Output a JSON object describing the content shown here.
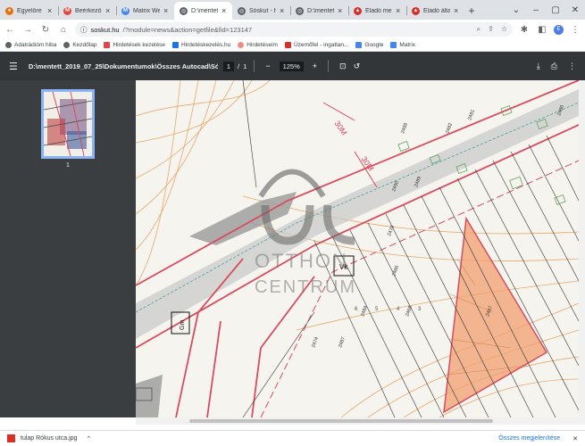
{
  "tabs": [
    {
      "title": "Egyelőre n",
      "favicon_color": "#e8710a",
      "favicon_glyph": "●",
      "active": false
    },
    {
      "title": "Beérkező le",
      "favicon_color": "#ea4335",
      "favicon_glyph": "M",
      "active": false
    },
    {
      "title": "Matrix We",
      "favicon_color": "#4285f4",
      "favicon_glyph": "M",
      "active": false
    },
    {
      "title": "D:\\mentett",
      "favicon_color": "#5f6368",
      "favicon_glyph": "◎",
      "active": true
    },
    {
      "title": "Sóskut - h",
      "favicon_color": "#5f6368",
      "favicon_glyph": "◎",
      "active": false
    },
    {
      "title": "D:\\mentett",
      "favicon_color": "#5f6368",
      "favicon_glyph": "◎",
      "active": false
    },
    {
      "title": "Eladó mez",
      "favicon_color": "#d93025",
      "favicon_glyph": "▲",
      "active": false
    },
    {
      "title": "Eladó álta",
      "favicon_color": "#d93025",
      "favicon_glyph": "▲",
      "active": false
    }
  ],
  "window_controls": {
    "tablist": "⌄",
    "minimize": "–",
    "maximize": "▢",
    "close": "✕"
  },
  "address": {
    "host": "soskut.hu",
    "path": "/?module=news&action=getfile&fid=123147",
    "icons": [
      "search-icon",
      "share-icon",
      "star-icon",
      "extensions-icon",
      "sidepanel-icon"
    ],
    "profile_initial": "E"
  },
  "bookmarks": [
    {
      "label": "Adatrádióm hiba",
      "icon": "globe-icon",
      "color": "#5f6368"
    },
    {
      "label": "Kezdőlap",
      "icon": "globe-icon",
      "color": "#5f6368"
    },
    {
      "label": "Hirdetések kezelése",
      "icon": "square-icon",
      "color": "#e04646"
    },
    {
      "label": "Hirdetéskezelés.hu",
      "icon": "arrow-icon",
      "color": "#1a73e8"
    },
    {
      "label": "Hirdetéseim",
      "icon": "circle-icon",
      "color": "#f28b82"
    },
    {
      "label": "Üzemőfel - ingatlan...",
      "icon": "house-icon",
      "color": "#d93025"
    },
    {
      "label": "Google",
      "icon": "google-icon",
      "color": "#4285f4"
    },
    {
      "label": "Matrix",
      "icon": "matrix-icon",
      "color": "#4285f4"
    }
  ],
  "pdf": {
    "filename": "D:\\mentett_2019_07_25\\Dokumentumok\\Összes Autocad\\Sós...",
    "page_current": "1",
    "page_total": "1",
    "zoom": "125%",
    "thumb_label": "1"
  },
  "map": {
    "distance_label_1": "30M",
    "distance_label_2": "30M",
    "watermark_top": "OTTHON",
    "watermark_bottom": "CENTRUM",
    "parcel_numbers": [
      "2490",
      "2481",
      "2489",
      "2482",
      "2499",
      "2470",
      "2484",
      "2487",
      "2468",
      "2474",
      "2466",
      "2467",
      "2486"
    ],
    "lot_numbers": [
      "6",
      "5",
      "4",
      "3"
    ],
    "zone_labels": [
      "Vk",
      "Gm"
    ],
    "colors": {
      "road_red": "#d94b5e",
      "contour": "#e8a86a",
      "highlight_fill": "#f0a070",
      "road_gray": "#b9b9b9",
      "building_green": "#5fa35f"
    }
  },
  "download": {
    "filename": "tulap Rókus utca.jpg",
    "show_all": "Összes megjelenítése"
  }
}
